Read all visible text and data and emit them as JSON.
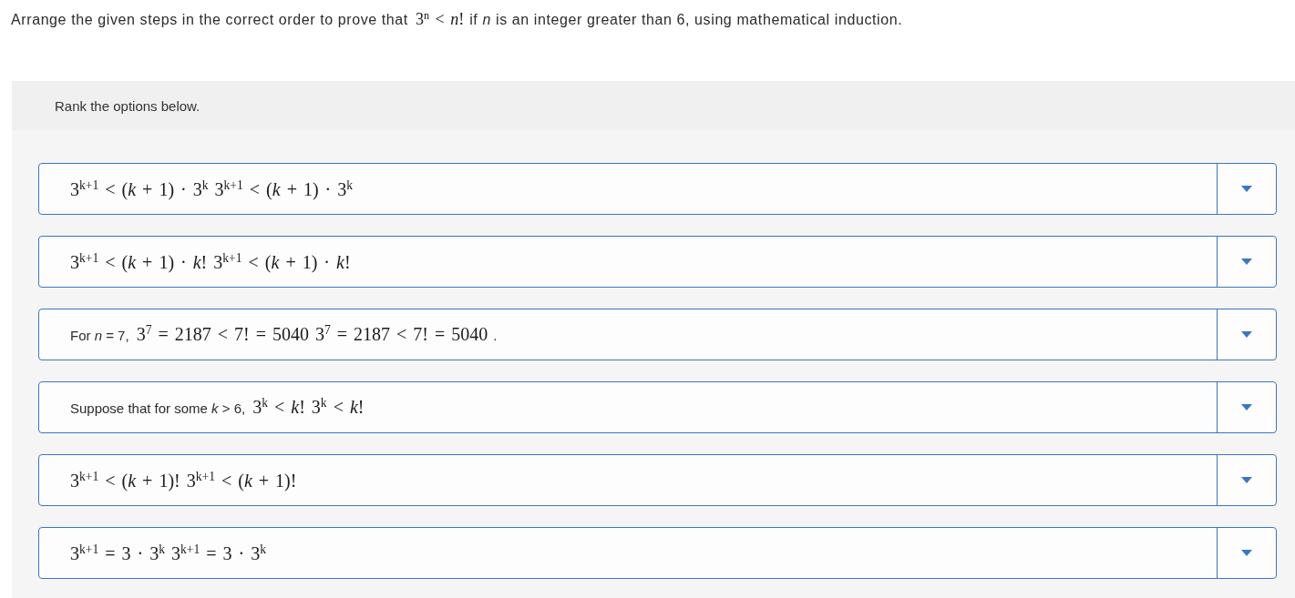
{
  "question": [
    {
      "kind": "text",
      "text": "Arrange the given steps in the correct order to prove that"
    },
    {
      "kind": "math",
      "text": "3$^{n}$ < *n*!"
    },
    {
      "kind": "text",
      "text": "if *n* is an integer greater than 6, using mathematical induction."
    }
  ],
  "panel": {
    "instruction": "Rank the options below."
  },
  "options": [
    {
      "segments": [
        {
          "kind": "math",
          "text": "3$^{k+1}$ < (*k* + 1) · 3$^{k}$ 3$^{k+1}$ < (*k* + 1) · 3$^{k}$"
        }
      ]
    },
    {
      "segments": [
        {
          "kind": "math",
          "text": "3$^{k+1}$ < (*k* + 1) · *k*! 3$^{k+1}$ < (*k* + 1) · *k*!"
        }
      ]
    },
    {
      "segments": [
        {
          "kind": "text",
          "text": "For *n* = 7,"
        },
        {
          "kind": "math",
          "text": "3$^{7}$ = 2187 < 7! = 5040 3$^{7}$ = 2187 < 7! = 5040"
        },
        {
          "kind": "text",
          "text": "."
        }
      ]
    },
    {
      "segments": [
        {
          "kind": "text",
          "text": "Suppose that for some *k* > 6,"
        },
        {
          "kind": "math",
          "text": "3$^{k}$ < *k*! 3$^{k}$ < *k*!"
        }
      ]
    },
    {
      "segments": [
        {
          "kind": "math",
          "text": "3$^{k+1}$ < (*k* + 1)! 3$^{k+1}$ < (*k* + 1)!"
        }
      ]
    },
    {
      "segments": [
        {
          "kind": "math",
          "text": "3$^{k+1}$ = 3 · 3$^{k}$ 3$^{k+1}$ = 3 · 3$^{k}$"
        }
      ]
    }
  ]
}
